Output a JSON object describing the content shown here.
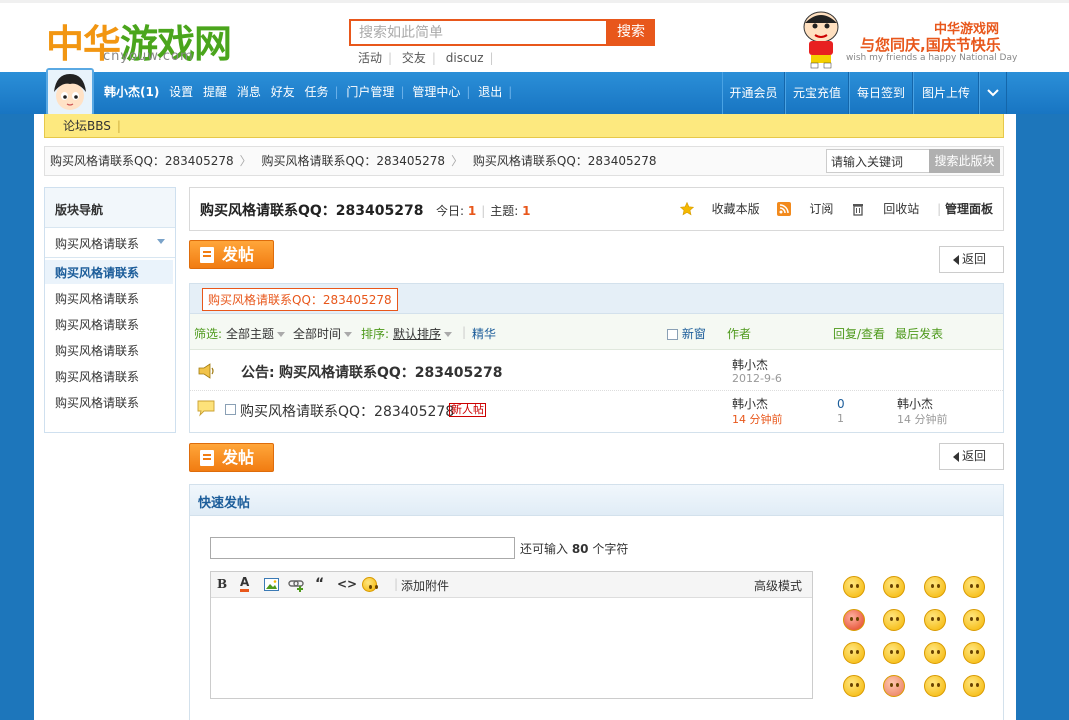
{
  "header": {
    "logo_text": "中华游戏网",
    "logo_domain": "cnyouw.com",
    "search_placeholder": "搜索如此简单 ",
    "search_button": "搜索",
    "search_links": [
      "活动",
      "交友",
      "discuz"
    ],
    "banner_line1": "中华游戏网",
    "banner_line2": "与您同庆,国庆节快乐",
    "banner_line3": "wish my friends a happy National Day"
  },
  "nav": {
    "username": "韩小杰(1)",
    "links": [
      "设置",
      "提醒",
      "消息",
      "好友",
      "任务",
      "门户管理",
      "管理中心",
      "退出"
    ],
    "right_buttons": [
      "开通会员",
      "元宝充值",
      "每日签到",
      "图片上传"
    ]
  },
  "bbs_bar": {
    "label": "论坛BBS"
  },
  "breadcrumb": {
    "items": [
      "购买风格请联系QQ：283405278",
      "购买风格请联系QQ：283405278",
      "购买风格请联系QQ：283405278"
    ],
    "keyword_placeholder": "请输入关键词",
    "search_button": "搜索此版块"
  },
  "sidebar": {
    "title": "版块导航",
    "select_value": "购买风格请联系",
    "items": [
      "购买风格请联系",
      "购买风格请联系",
      "购买风格请联系",
      "购买风格请联系",
      "购买风格请联系",
      "购买风格请联系"
    ]
  },
  "forum_head": {
    "title": "购买风格请联系QQ：283405278",
    "today_label": "今日: ",
    "today_value": "1",
    "threads_label": "主题: ",
    "threads_value": "1",
    "tools": [
      "收藏本版",
      "订阅",
      "回收站",
      "管理面板"
    ]
  },
  "post_button": "发帖",
  "back_button": "返回",
  "thread_list": {
    "tag": "购买风格请联系QQ：283405278",
    "filter_label": "筛选:",
    "filter_all_topics": "全部主题",
    "filter_all_time": "全部时间",
    "sort_label": "排序:",
    "sort_value": "默认排序",
    "digest": "精华",
    "new_window": "新窗",
    "col_author": "作者",
    "col_replies": "回复/查看",
    "col_last": "最后发表",
    "announcement": {
      "prefix": "公告: ",
      "title": "购买风格请联系QQ：283405278",
      "author": "韩小杰",
      "date": "2012-9-6"
    },
    "threads": [
      {
        "title": "购买风格请联系QQ：283405278",
        "badge": "新人帖",
        "author": "韩小杰",
        "time": "14 分钟前",
        "replies": "0",
        "views": "1",
        "last_author": "韩小杰",
        "last_time": "14 分钟前"
      }
    ]
  },
  "quick_post": {
    "title": "快速发帖",
    "remain_prefix": "还可输入 ",
    "remain_count": "80",
    "remain_suffix": " 个字符",
    "toolbar_attach": "添加附件",
    "toolbar_advanced": "高级模式"
  },
  "colors": {
    "primary_blue": "#1875c2",
    "accent_orange": "#e8571b",
    "bbs_yellow": "#fde97f"
  }
}
